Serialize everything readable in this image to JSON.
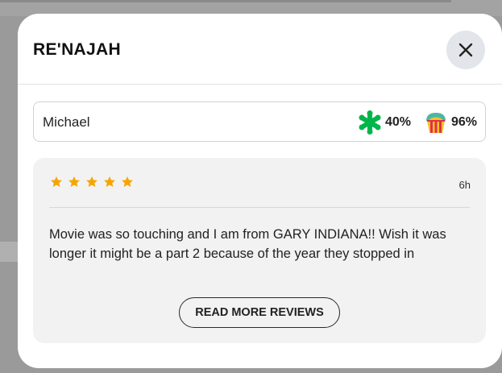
{
  "modal": {
    "title": "RE'NAJAH",
    "close_icon": "close-icon"
  },
  "reviewer": {
    "name": "Michael",
    "tomatometer": {
      "icon": "splat-icon",
      "value": "40%"
    },
    "popcornmeter": {
      "icon": "popcorn-bucket-icon",
      "value": "96%"
    }
  },
  "review": {
    "rating_stars": 5,
    "time_ago": "6h",
    "text": "Movie was so touching and I am from GARY INDIANA!! Wish it was longer it might be a part 2 because of the year they stopped in",
    "read_more_label": "READ MORE REVIEWS"
  },
  "colors": {
    "star": "#f5a500",
    "splat": "#00b64a",
    "popcorn_teal": "#4bb7a6",
    "popcorn_red": "#e0314b",
    "popcorn_yellow": "#f6c325"
  }
}
